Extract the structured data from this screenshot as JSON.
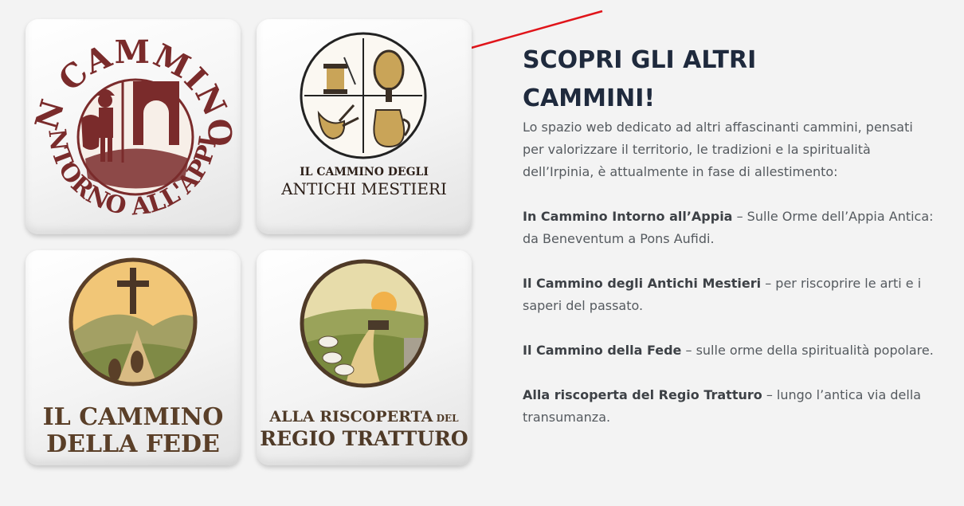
{
  "tiles": [
    {
      "id": "appia",
      "curved_top": "IN CAMMINO",
      "curved_bottom": "INTORNO ALL'APPIA"
    },
    {
      "id": "mestieri",
      "caption_line1": "IL CAMMINO DEGLI",
      "caption_line2": "ANTICHI MESTIERI"
    },
    {
      "id": "fede",
      "caption_line1": "IL CAMMINO",
      "caption_line2": "DELLA FEDE"
    },
    {
      "id": "tratturo",
      "caption_line1_main": "ALLA RISCOPERTA",
      "caption_line1_small": " DEL",
      "caption_line2": "REGIO TRATTURO"
    }
  ],
  "heading": {
    "line1": "SCOPRI GLI ALTRI",
    "line2": "CAMMINI!"
  },
  "intro": "Lo spazio web dedicato ad altri affascinanti cammini, pensati per valorizzare il territorio, le tradizioni e la spiritualità dell’Irpinia, è attualmente in fase di allestimento:",
  "items": [
    {
      "title": "In Cammino Intorno all’Appia",
      "desc": " – Sulle Orme dell’Appia Antica: da Beneventum a Pons Aufidi."
    },
    {
      "title": "Il Cammino degli Antichi Mestieri",
      "desc": " – per riscoprire le arti e i saperi del passato."
    },
    {
      "title": "Il Cammino della Fede",
      "desc": " – sulle orme della spiritualità popolare."
    },
    {
      "title": "Alla riscoperta del Regio Tratturo",
      "desc": " – lungo l’antica via della transumanza."
    }
  ],
  "colors": {
    "arrow": "#e0141a",
    "heading": "#1f2a3d",
    "appia": "#7a2b2b",
    "text": "#555a5f"
  },
  "icons": [
    "soldier-icon",
    "arch-icon",
    "thread-spool-icon",
    "needle-icon",
    "basket-paddle-icon",
    "bagpipe-icon",
    "jug-icon",
    "cross-icon",
    "footprints-icon",
    "sheep-icon",
    "cow-icon",
    "sun-icon",
    "annotation-arrow-icon"
  ]
}
